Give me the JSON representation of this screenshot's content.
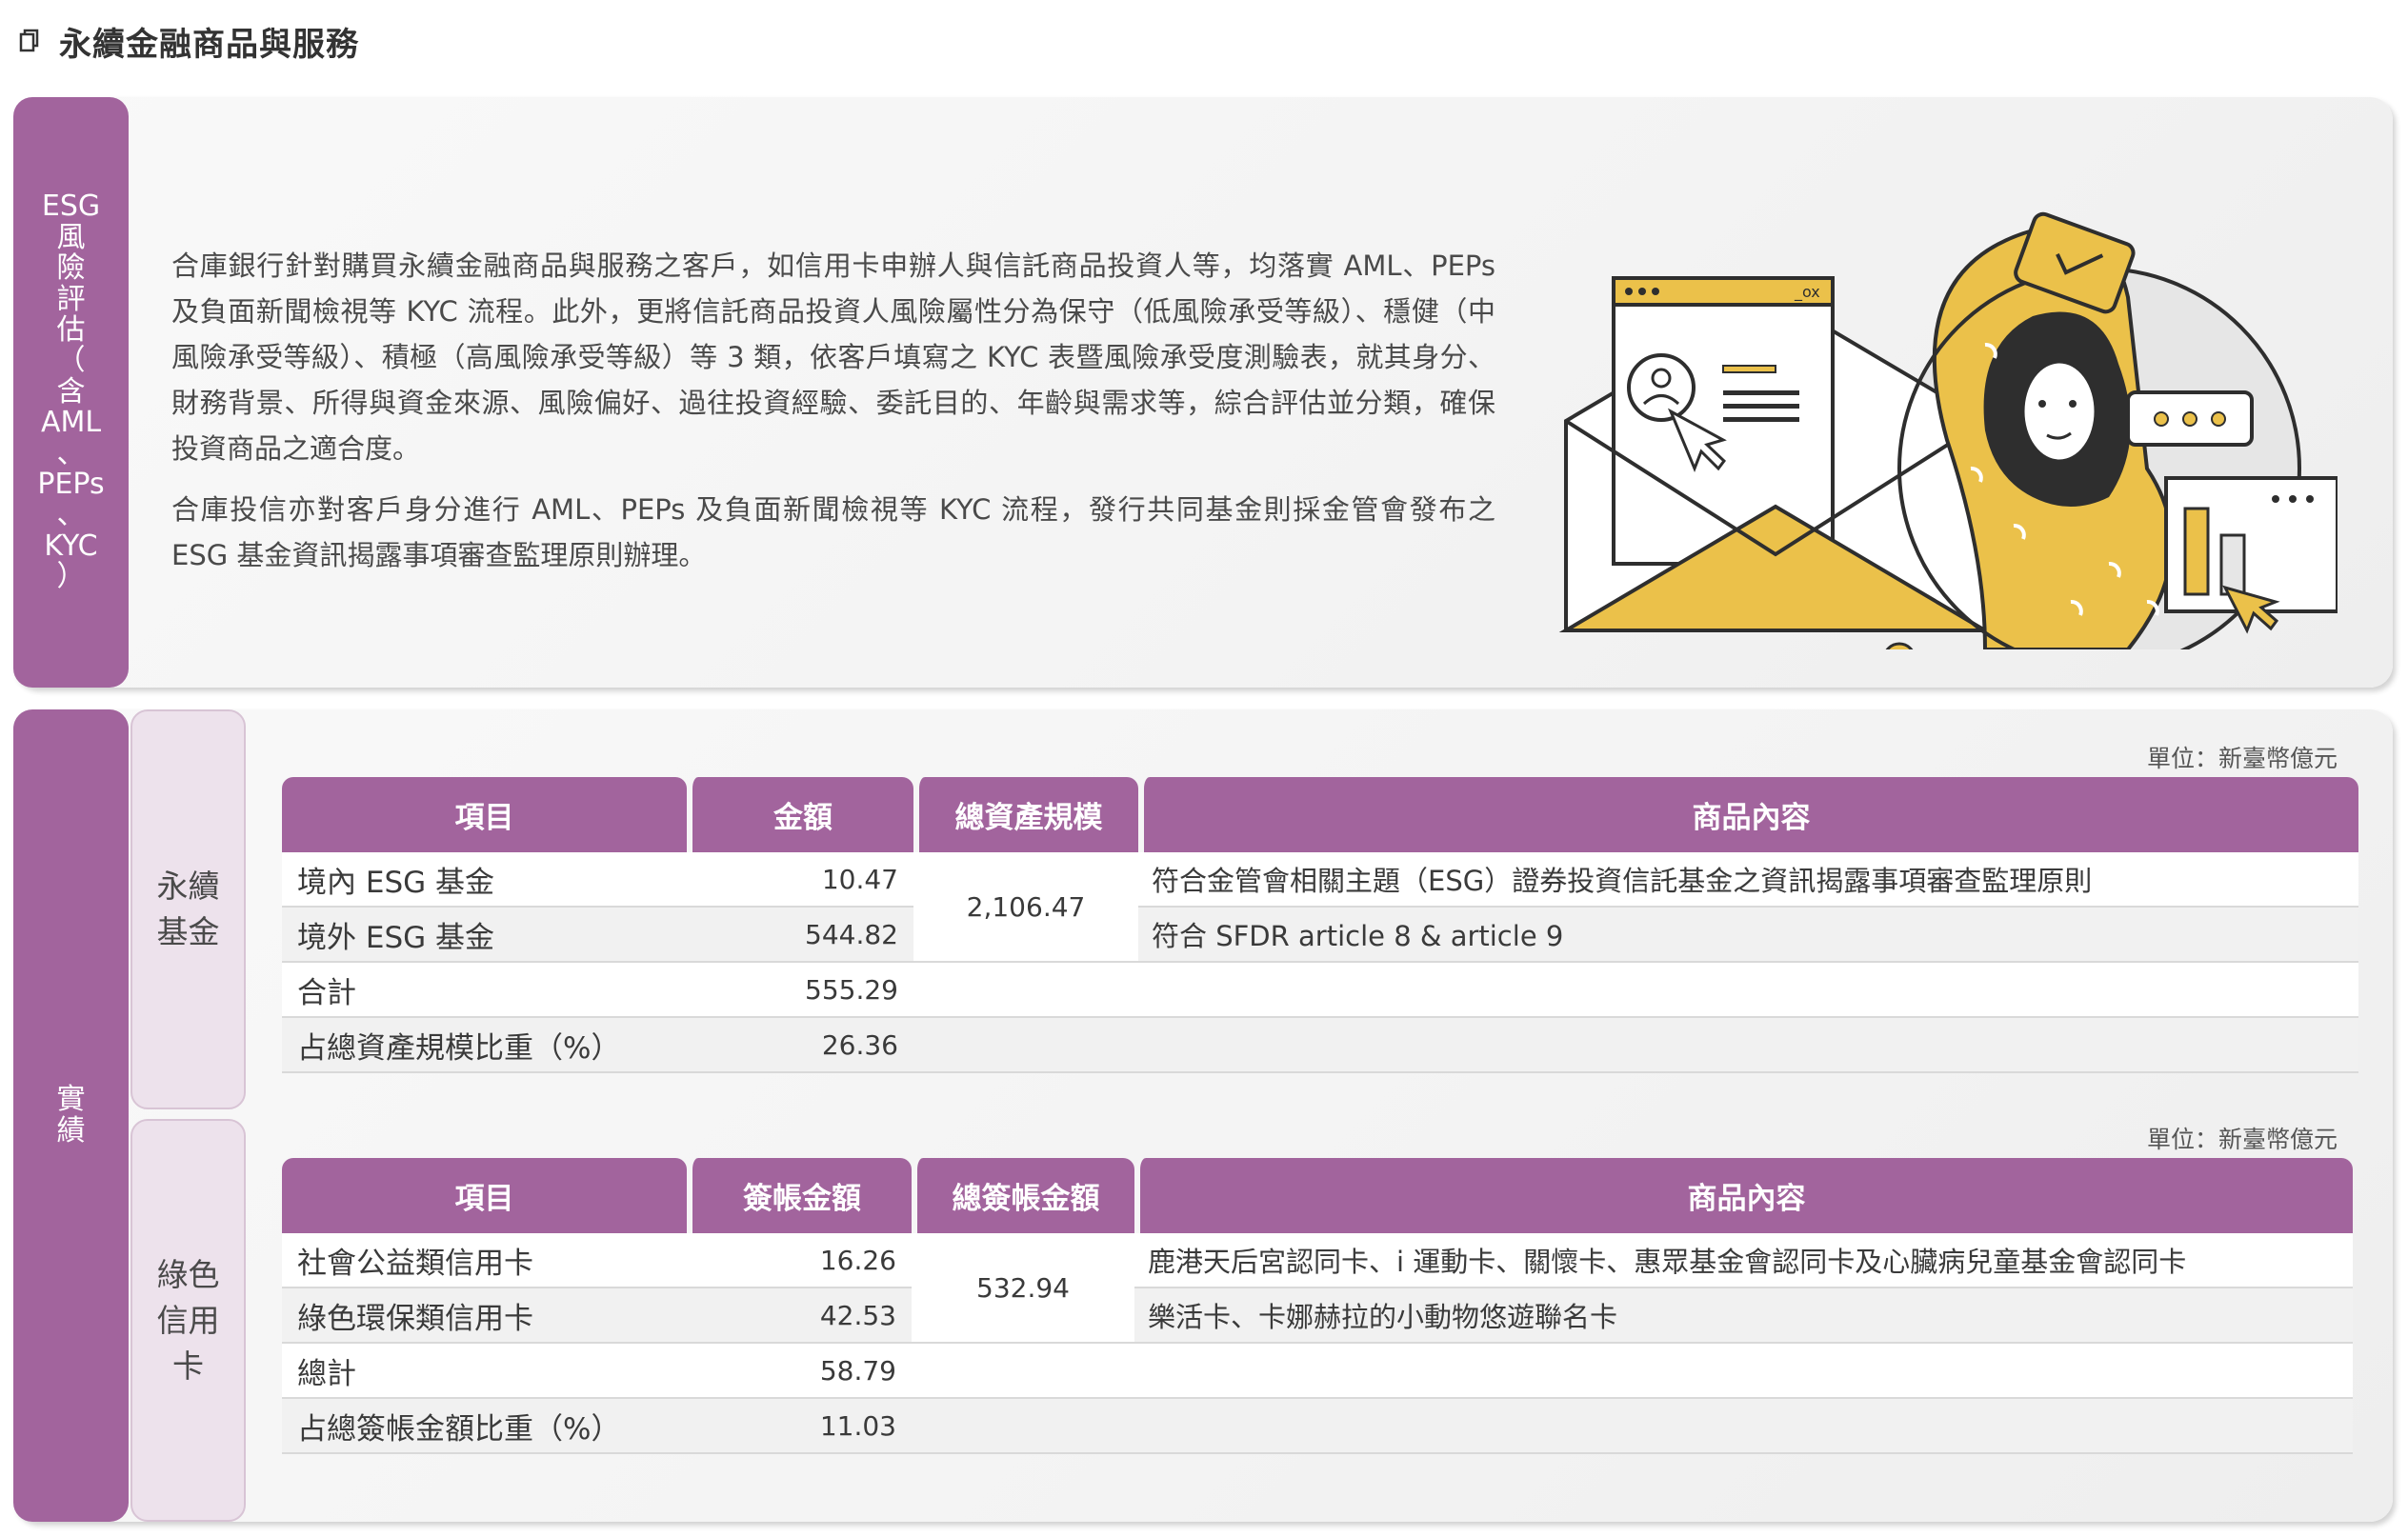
{
  "header": {
    "title": "永續金融商品與服務"
  },
  "risk": {
    "tab_lines": [
      "ESG",
      "風",
      "險",
      "評",
      "估",
      "（",
      "含",
      "AML",
      "、",
      "PEPs",
      "、",
      "KYC",
      "）"
    ],
    "para1": "合庫銀行針對購買永續金融商品與服務之客戶，如信用卡申辦人與信託商品投資人等，均落實 AML、PEPs 及負面新聞檢視等 KYC 流程。此外，更將信託商品投資人風險屬性分為保守（低風險承受等級）、穩健（中風險承受等級）、積極（高風險承受等級）等 3 類，依客戶填寫之 KYC 表暨風險承受度測驗表，就其身分、財務背景、所得與資金來源、風險偏好、過往投資經驗、委託目的、年齡與需求等，綜合評估並分類，確保投資商品之適合度。",
    "para2": "合庫投信亦對客戶身分進行 AML、PEPs 及負面新聞檢視等 KYC 流程，發行共同基金則採金管會發布之 ESG 基金資訊揭露事項審查監理原則辦理。"
  },
  "results": {
    "tab_lines": [
      "實",
      "績"
    ],
    "fund": {
      "tab_lines": [
        "永續",
        "基金"
      ],
      "unit": "單位：新臺幣億元",
      "headers": [
        "項目",
        "金額",
        "總資產規模",
        "商品內容"
      ],
      "total_assets": "2,106.47",
      "rows": [
        {
          "item": "境內 ESG 基金",
          "amount": "10.47",
          "desc": "符合金管會相關主題（ESG）證券投資信託基金之資訊揭露事項審查監理原則"
        },
        {
          "item": "境外 ESG 基金",
          "amount": "544.82",
          "desc": "符合 SFDR article 8 & article 9"
        },
        {
          "item": "合計",
          "amount": "555.29",
          "desc": ""
        },
        {
          "item": "占總資產規模比重（%）",
          "amount": "26.36",
          "desc": ""
        }
      ]
    },
    "card": {
      "tab_lines": [
        "綠色",
        "信用",
        "卡"
      ],
      "unit": "單位：新臺幣億元",
      "headers": [
        "項目",
        "簽帳金額",
        "總簽帳金額",
        "商品內容"
      ],
      "total": "532.94",
      "rows": [
        {
          "item": "社會公益類信用卡",
          "amount": "16.26",
          "desc": "鹿港天后宮認同卡、i 運動卡、關懷卡、惠眾基金會認同卡及心臟病兒童基金會認同卡"
        },
        {
          "item": "綠色環保類信用卡",
          "amount": "42.53",
          "desc": "樂活卡、卡娜赫拉的小動物悠遊聯名卡"
        },
        {
          "item": "總計",
          "amount": "58.79",
          "desc": ""
        },
        {
          "item": "占總簽帳金額比重（%）",
          "amount": "11.03",
          "desc": ""
        }
      ]
    }
  },
  "colors": {
    "accent": "#a2649d",
    "accent_light": "#ede2ec",
    "illustration_yellow": "#ebc14a"
  }
}
